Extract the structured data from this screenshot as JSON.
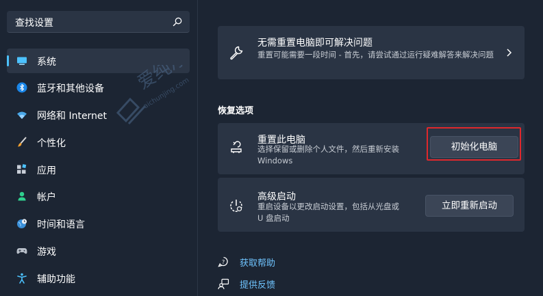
{
  "search": {
    "placeholder": "查找设置",
    "icon": "search-icon"
  },
  "sidebar": {
    "accent": "#4cc2ff",
    "items": [
      {
        "label": "系统",
        "icon": "monitor-icon",
        "active": true
      },
      {
        "label": "蓝牙和其他设备",
        "icon": "bluetooth-icon"
      },
      {
        "label": "网络和 Internet",
        "icon": "wifi-icon"
      },
      {
        "label": "个性化",
        "icon": "brush-icon"
      },
      {
        "label": "应用",
        "icon": "apps-icon"
      },
      {
        "label": "帐户",
        "icon": "account-icon"
      },
      {
        "label": "时间和语言",
        "icon": "globe-clock-icon"
      },
      {
        "label": "游戏",
        "icon": "gamepad-icon"
      },
      {
        "label": "辅助功能",
        "icon": "accessibility-icon"
      }
    ]
  },
  "main": {
    "troubleshoot": {
      "title": "无需重置电脑即可解决问题",
      "desc": "重置可能需要一段时间 - 首先，请尝试通过运行疑难解答来解决问题",
      "icon": "wrench-icon"
    },
    "section_title": "恢复选项",
    "reset": {
      "title": "重置此电脑",
      "desc_line1": "选择保留或删除个人文件，然后重新安装",
      "desc_line2": "Windows",
      "button": "初始化电脑",
      "icon": "reset-pc-icon",
      "highlight_color": "#e0282c"
    },
    "advanced": {
      "title": "高级启动",
      "desc_line1": "重启设备以更改启动设置，包括从光盘或",
      "desc_line2": "U 盘启动",
      "button": "立即重新启动",
      "icon": "advanced-startup-icon"
    },
    "links": [
      {
        "label": "获取帮助",
        "icon": "help-icon"
      },
      {
        "label": "提供反馈",
        "icon": "feedback-icon"
      }
    ],
    "link_color": "#6fc4ff"
  },
  "watermark": {
    "text_cn": "爱纯净",
    "text_en": "aichunjing.com"
  }
}
